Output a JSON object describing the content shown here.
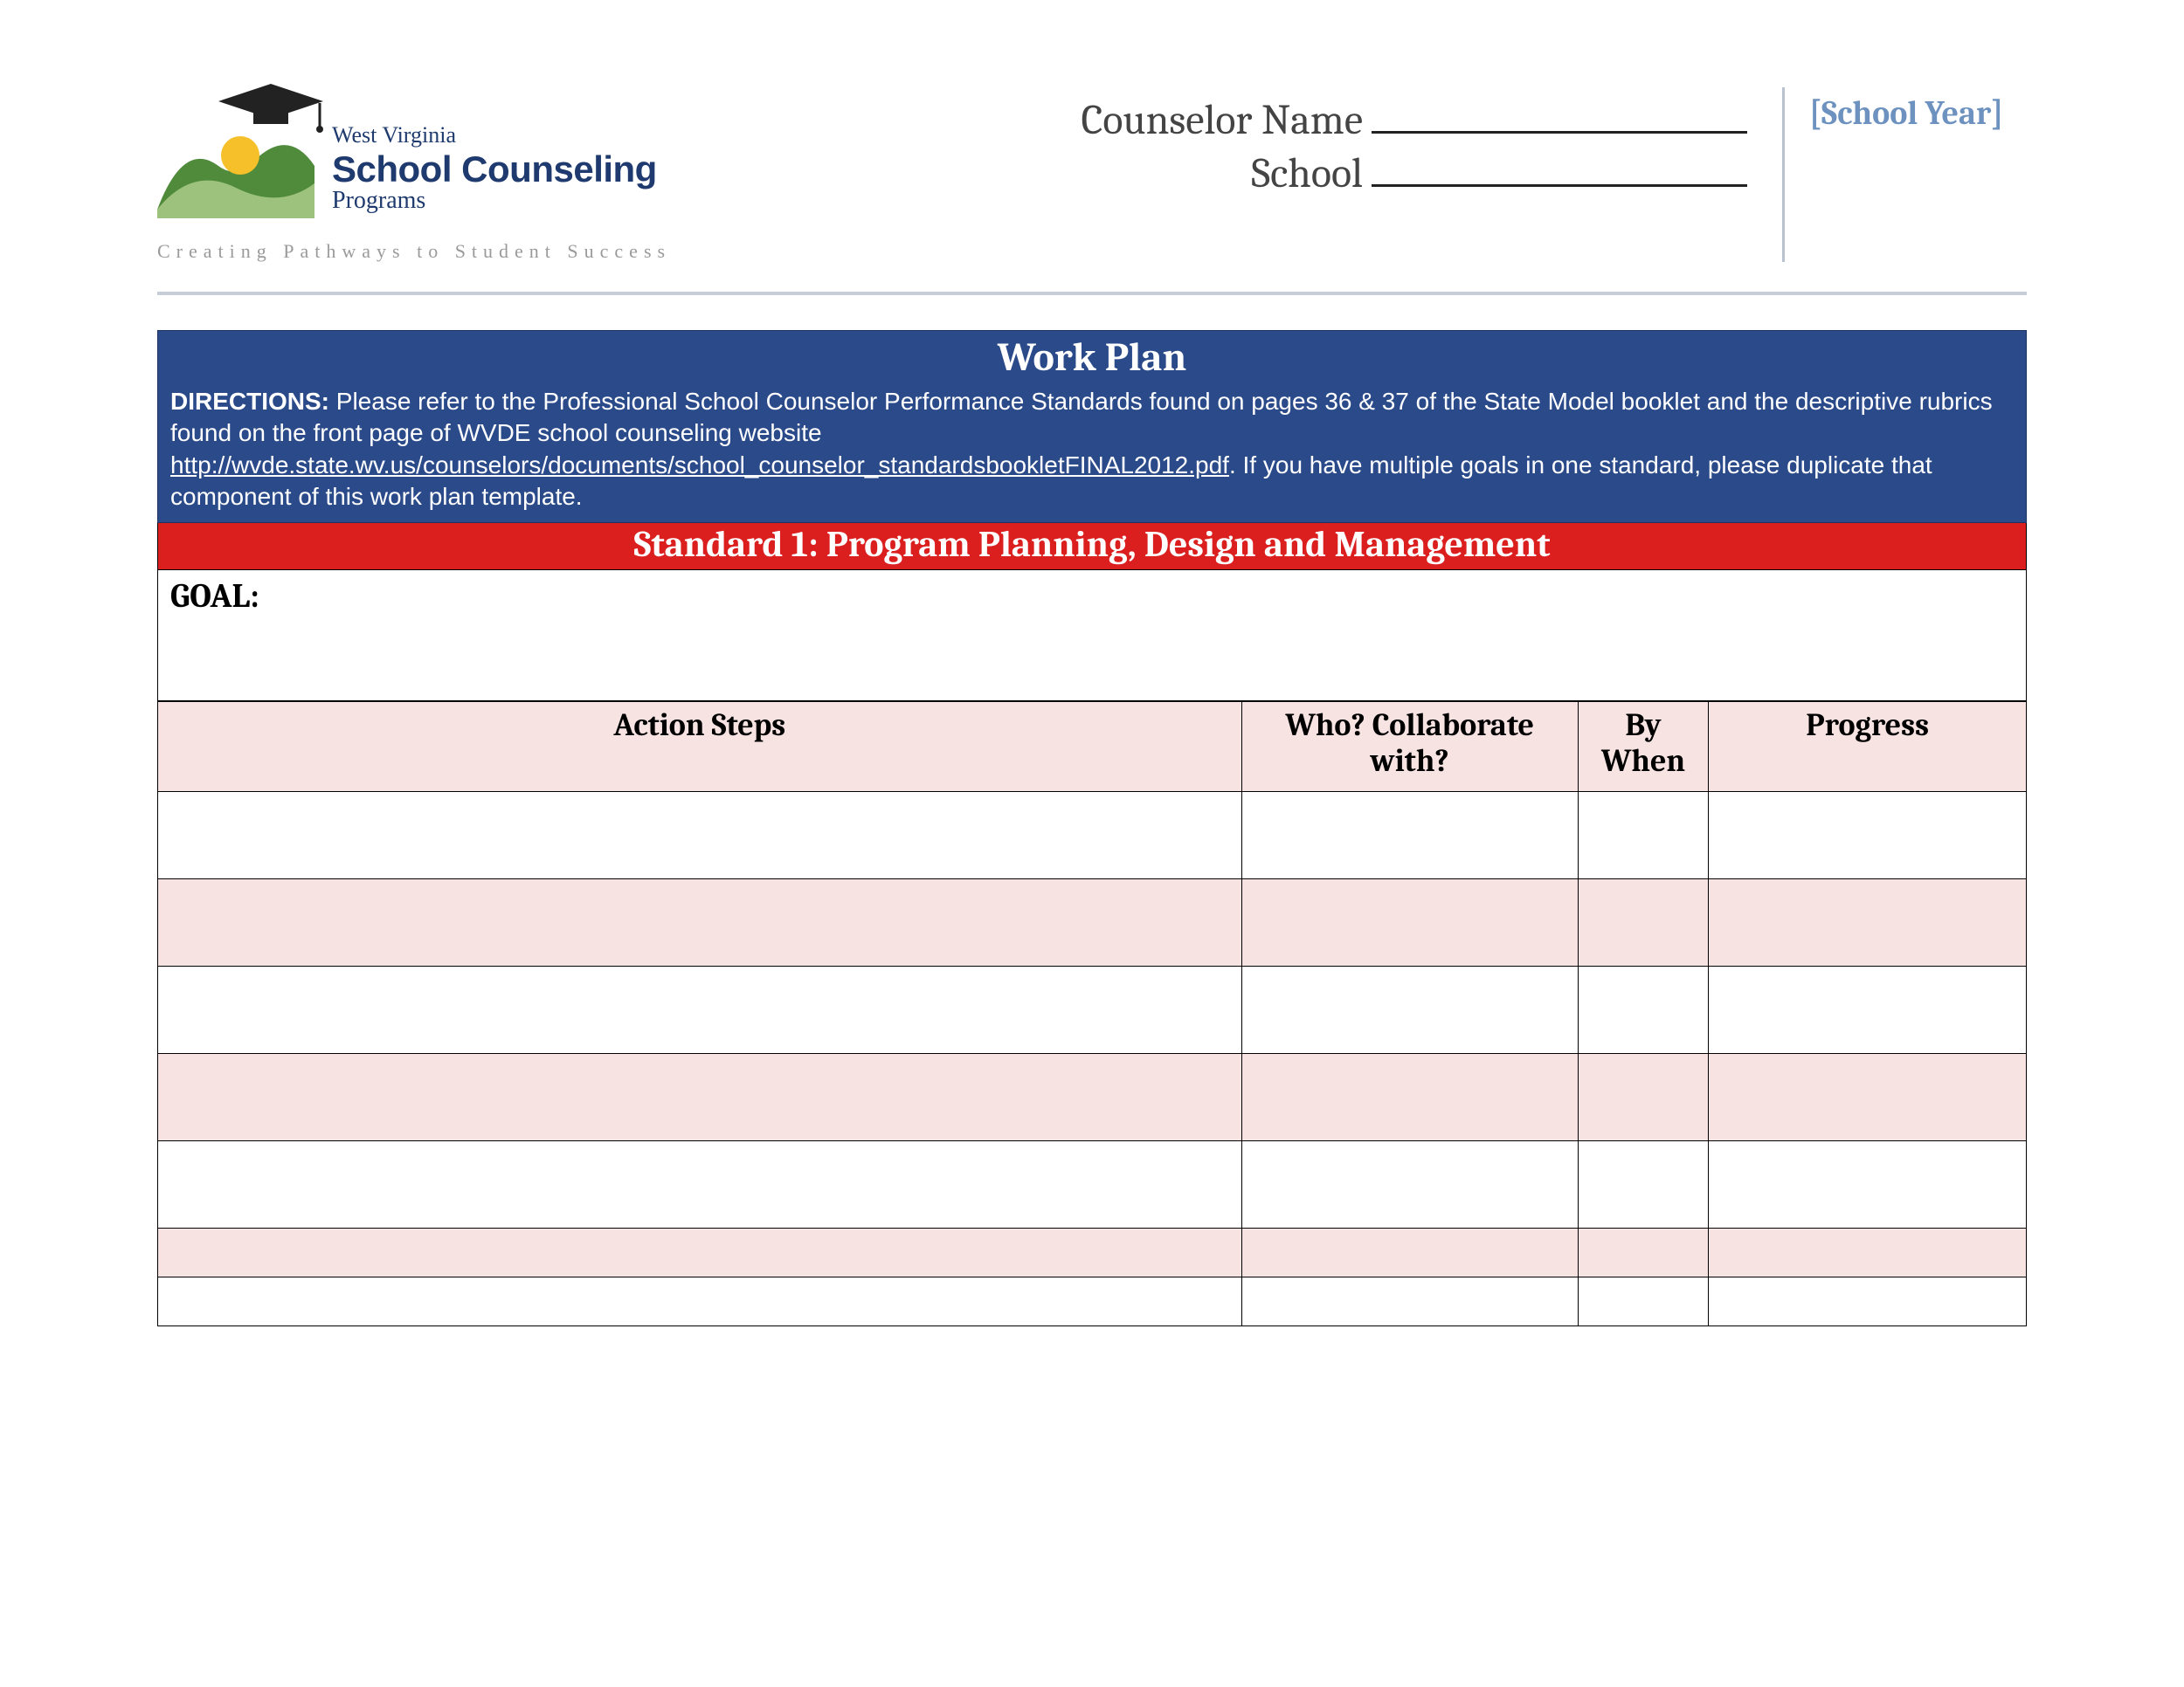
{
  "logo": {
    "line1": "West Virginia",
    "line2": "School Counseling",
    "line3": "Programs",
    "tagline": "Creating Pathways to Student Success"
  },
  "header": {
    "counselor_label": "Counselor Name",
    "school_label": "School",
    "school_year": "[School Year]"
  },
  "panel": {
    "title": "Work Plan",
    "directions_label": "DIRECTIONS:",
    "directions_text_1": " Please refer to the Professional School Counselor Performance Standards found on pages 36 & 37 of the State Model booklet and the descriptive rubrics found on the front page of  WVDE school counseling website ",
    "directions_link": "http://wvde.state.wv.us/counselors/documents/school_counselor_standardsbookletFINAL2012.pdf",
    "directions_text_2": ". If you have multiple goals in one standard, please duplicate that component of this work plan template.",
    "standard_title": "Standard 1: Program Planning, Design and Management",
    "goal_label": "GOAL:"
  },
  "table": {
    "headers": {
      "action": "Action Steps",
      "who": "Who? Collaborate with?",
      "when": "By When",
      "progress": "Progress"
    },
    "rows": [
      {
        "action": "",
        "who": "",
        "when": "",
        "progress": ""
      },
      {
        "action": "",
        "who": "",
        "when": "",
        "progress": ""
      },
      {
        "action": "",
        "who": "",
        "when": "",
        "progress": ""
      },
      {
        "action": "",
        "who": "",
        "when": "",
        "progress": ""
      },
      {
        "action": "",
        "who": "",
        "when": "",
        "progress": ""
      },
      {
        "action": "",
        "who": "",
        "when": "",
        "progress": ""
      },
      {
        "action": "",
        "who": "",
        "when": "",
        "progress": ""
      }
    ]
  }
}
